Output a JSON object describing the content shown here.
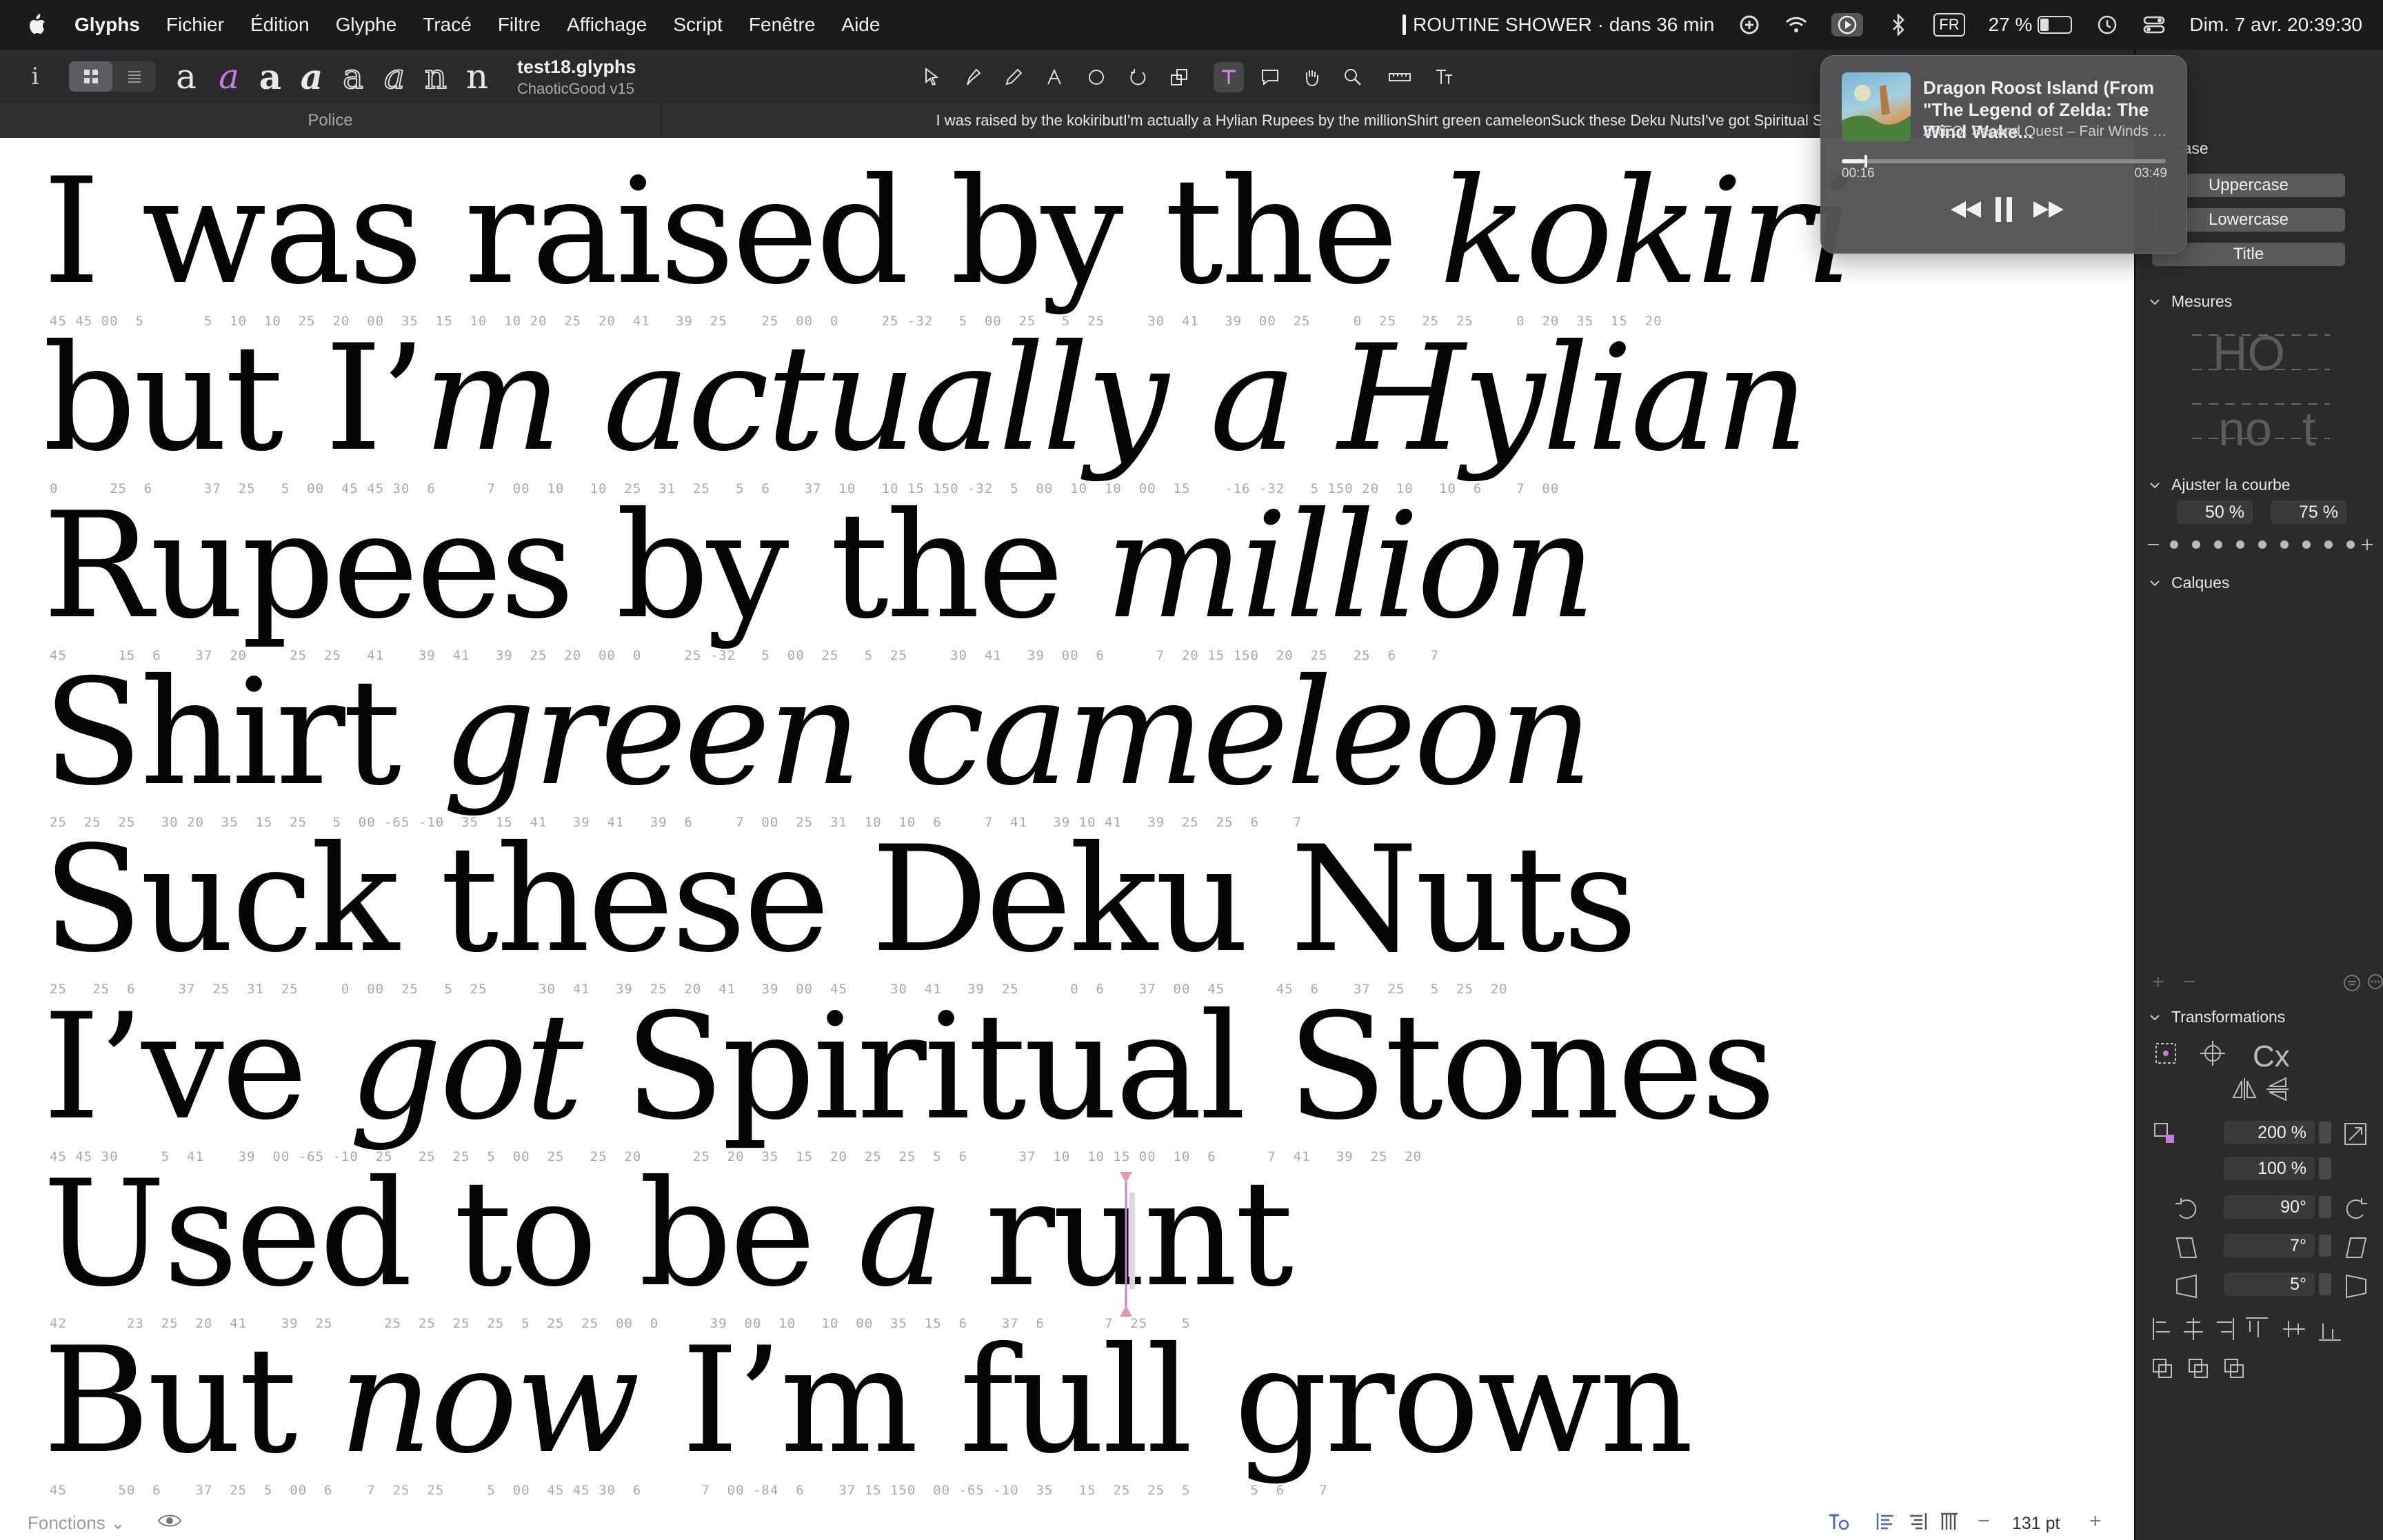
{
  "menubar": {
    "app": "Glyphs",
    "menus": [
      "Fichier",
      "Édition",
      "Glyphe",
      "Tracé",
      "Filtre",
      "Affichage",
      "Script",
      "Fenêtre",
      "Aide"
    ],
    "reminder": "ROUTINE SHOWER · dans 36 min",
    "input_source": "FR",
    "battery": "27 %",
    "datetime": "Dim. 7 avr.  20:39:30"
  },
  "toolbar": {
    "info_label": "i",
    "glyph_chips": [
      "a",
      "a",
      "a",
      "a",
      "a",
      "a",
      "n",
      "n"
    ],
    "doc_title": "test18.glyphs",
    "doc_subtitle": "ChaoticGood v15"
  },
  "tabs": {
    "font_tab": "Police",
    "text_tab": "I was raised by the kokiributI'm actually a Hylian Rupees by the millionShirt green cameleonSuck these Deku NutsI've got Spiritual Stones"
  },
  "editor": {
    "lines": [
      {
        "roman": "I was raised by the ",
        "italic": "kokiri",
        "tail": ""
      },
      {
        "roman": "but I’",
        "italic": "m actually a Hylian",
        "tail": ""
      },
      {
        "roman": "Rupees by the ",
        "italic": "million",
        "tail": ""
      },
      {
        "roman": "Shirt ",
        "italic": "green cameleon",
        "tail": ""
      },
      {
        "roman": "Suck these Deku Nuts",
        "italic": "",
        "tail": ""
      },
      {
        "roman": "I’ve ",
        "italic": "got",
        "tail": " Spiritual Stones"
      },
      {
        "roman": "Used to be ",
        "italic": "a",
        "tail": " runt"
      },
      {
        "roman": "But ",
        "italic": "now",
        "tail": " I’m full grown"
      }
    ],
    "kerning_rows": [
      "45 45 00  5       5  10  10  25  20  00  35  15  10  10 20  25  20  41   39  25    25  00  0     25 -32   5  00  25   5  25     30  41   39  00  25     0  25   25  25     0  20  35  15  20",
      "0      25  6      37  25   5  00  45 45 30  6      7  00  10   10  25  31  25   5  6    37  10   10 15 150 -32  5  00  10  10  00  15    -16 -32   5 150 20  10   10  6    7  00",
      "45      15  6    37  20     25  25   41    39  41   39  25  20  00  0     25 -32   5  00  25   5  25     30  41   39  00  6      7  20 15 150  20  25   25  6    7",
      "25  25  25   30 20  35  15  25   5  00 -65 -10  35  15  41   39  41   39  6     7  00  25  31  10  10  6     7  41   39 10 41   39  25  25  6    7",
      "25   25  6     37  25  31  25     0  00  25   5  25      30  41   39  25  20  41   39  00  45     30  41   39  25      0  6    37  00  45      45  6    37  25   5  25  20",
      "45 45 30     5  41    39  00 -65 -10  25   25  25  5  00  25   25  20      25  20  35  15  20  25  25  5  6      37  10  10 15 00  10  6      7  41   39  25  20",
      "42       23  25  20  41    39  25      25  25  25  25  5  25  25  00  0      39  00  10   10  00  35  15  6    37  6       7  25    5",
      "45      50  6    37  25  5  00  6    7  25  25     5  00  45 45 30  6       7  00 -84  6    37 15 150  00 -65 -10  35   15  25  25  5       5  6    7"
    ],
    "functions_label": "Fonctions",
    "zoom": "131 pt"
  },
  "inspector": {
    "case_header": "Case",
    "case_buttons": [
      "Uppercase",
      "Lowercase",
      "Title"
    ],
    "measures_header": "Mesures",
    "curve_header": "Ajuster la courbe",
    "curve_values": [
      "50 %",
      "75 %"
    ],
    "layers_header": "Calques",
    "transforms_header": "Transformations",
    "scale_x": "200 %",
    "scale_y": "100 %",
    "rotate": "90°",
    "slant": "7°",
    "skew": "5°"
  },
  "nowplaying": {
    "title": "Dragon Roost Island (From \"The Legend of Zelda: The Wind Wake...",
    "artist": "ZREO: Second Quest – Fair Winds & Fo...",
    "elapsed": "00:16",
    "total": "03:49",
    "progress": 0.07
  },
  "colors": {
    "accent": "#b06ad0",
    "canvas": "#ffffff",
    "chrome": "#2a2a2c"
  }
}
